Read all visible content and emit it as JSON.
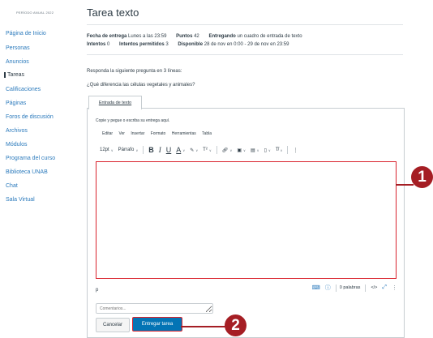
{
  "sidebar": {
    "period": "PERÍODO ANUAL 2022",
    "items": [
      {
        "label": "Página de Inicio"
      },
      {
        "label": "Personas"
      },
      {
        "label": "Anuncios"
      },
      {
        "label": "Tareas"
      },
      {
        "label": "Calificaciones"
      },
      {
        "label": "Páginas"
      },
      {
        "label": "Foros de discusión"
      },
      {
        "label": "Archivos"
      },
      {
        "label": "Módulos"
      },
      {
        "label": "Programa del curso"
      },
      {
        "label": "Biblioteca UNAB"
      },
      {
        "label": "Chat"
      },
      {
        "label": "Sala Virtual"
      }
    ],
    "active_index": 3
  },
  "assignment": {
    "title": "Tarea texto",
    "due_label": "Fecha de entrega",
    "due_value": "Lunes a las 23:59",
    "points_label": "Puntos",
    "points_value": "42",
    "submitting_label": "Entregando",
    "submitting_value": "un cuadro de entrada de texto",
    "attempts_label": "Intentos",
    "attempts_value": "0",
    "allowed_label": "Intentos permitidos",
    "allowed_value": "3",
    "available_label": "Disponible",
    "available_value": "28 de nov en 0:00 - 29 de nov en 23:59",
    "instruction": "Responda la siguiente pregunta en 3 líneas:",
    "question": "¿Qué diferencia las células vegetales y animales?"
  },
  "editor": {
    "tab_label": "Entrada de texto",
    "hint": "Copie y pegue o escriba su entrega aquí.",
    "menu": [
      "Editar",
      "Ver",
      "Insertar",
      "Formato",
      "Herramientas",
      "Tabla"
    ],
    "font_size": "12pt",
    "block_format": "Párrafo",
    "status_path": "p",
    "word_count": "0 palabras",
    "html_toggle": "</>"
  },
  "comments_placeholder": "Comentarios...",
  "buttons": {
    "cancel": "Cancelar",
    "submit": "Entregar tarea"
  },
  "callouts": [
    "1",
    "2"
  ],
  "colors": {
    "accent": "#0374b5",
    "link": "#2b7abc",
    "highlight": "#d9232e",
    "callout": "#a51e24"
  }
}
